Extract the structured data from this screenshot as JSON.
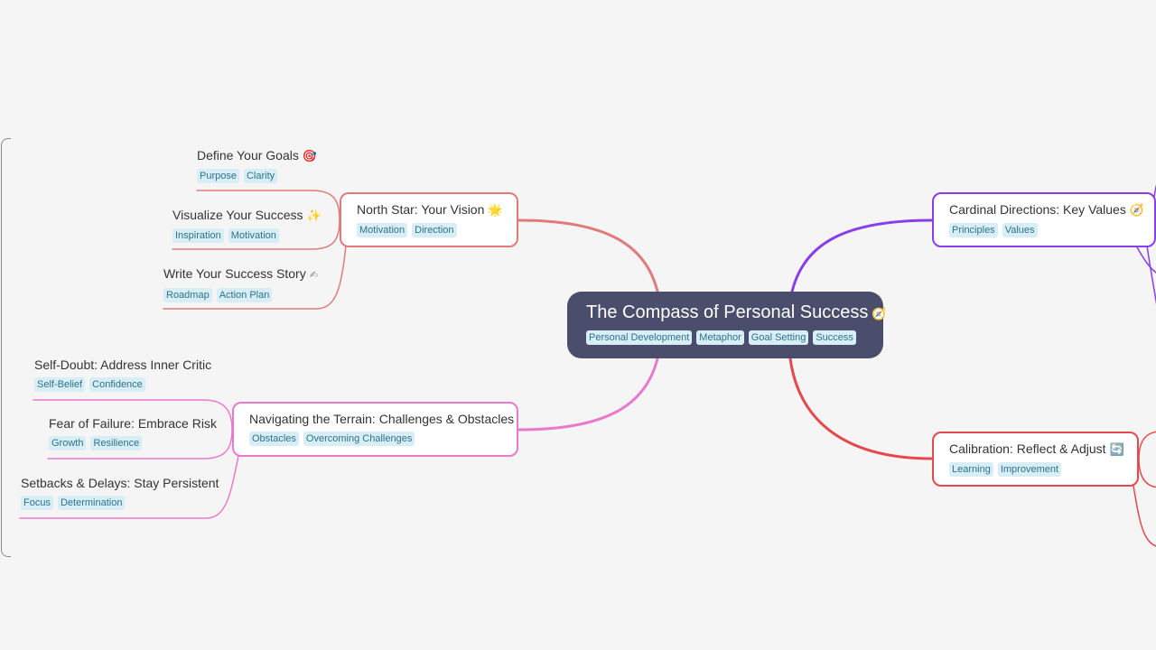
{
  "root": {
    "title": "The Compass of Personal Success",
    "icon": "compass-icon",
    "emoji": "🧭",
    "tags": [
      "Personal Development",
      "Metaphor",
      "Goal Setting",
      "Success"
    ]
  },
  "branches": [
    {
      "id": "north-star",
      "title": "North Star: Your Vision",
      "emoji": "🌟",
      "icon": "glowing-star-icon",
      "color": "#e07b7b",
      "tags": [
        "Motivation",
        "Direction"
      ],
      "children": [
        {
          "title": "Define Your Goals",
          "emoji": "🎯",
          "icon": "target-icon",
          "tags": [
            "Purpose",
            "Clarity"
          ]
        },
        {
          "title": "Visualize Your Success",
          "emoji": "✨",
          "icon": "sparkles-icon",
          "tags": [
            "Inspiration",
            "Motivation"
          ]
        },
        {
          "title": "Write Your Success Story",
          "emoji": "✍",
          "icon": "writing-hand-icon",
          "tags": [
            "Roadmap",
            "Action Plan"
          ]
        }
      ]
    },
    {
      "id": "terrain",
      "title": "Navigating the Terrain: Challenges & Obstacles",
      "emoji": "",
      "color": "#e97acb",
      "tags": [
        "Obstacles",
        "Overcoming Challenges"
      ],
      "children": [
        {
          "title": "Self-Doubt: Address Inner Critic",
          "emoji": "",
          "tags": [
            "Self-Belief",
            "Confidence"
          ]
        },
        {
          "title": "Fear of Failure: Embrace Risk",
          "emoji": "",
          "tags": [
            "Growth",
            "Resilience"
          ]
        },
        {
          "title": "Setbacks & Delays: Stay Persistent",
          "emoji": "",
          "tags": [
            "Focus",
            "Determination"
          ]
        }
      ]
    },
    {
      "id": "cardinal",
      "title": "Cardinal Directions: Key Values",
      "emoji": "🧭",
      "icon": "compass-icon",
      "color": "#8a3ee8",
      "tags": [
        "Principles",
        "Values"
      ],
      "children": []
    },
    {
      "id": "calibration",
      "title": "Calibration: Reflect & Adjust",
      "emoji": "🔄",
      "icon": "refresh-arrows-icon",
      "color": "#e5484d",
      "tags": [
        "Learning",
        "Improvement"
      ],
      "children": []
    }
  ],
  "colors": {
    "background": "#f5f5f5",
    "root_fill": "#4a4d6b",
    "tag_fill": "#d7eef6",
    "tag_text": "#2e7288"
  }
}
